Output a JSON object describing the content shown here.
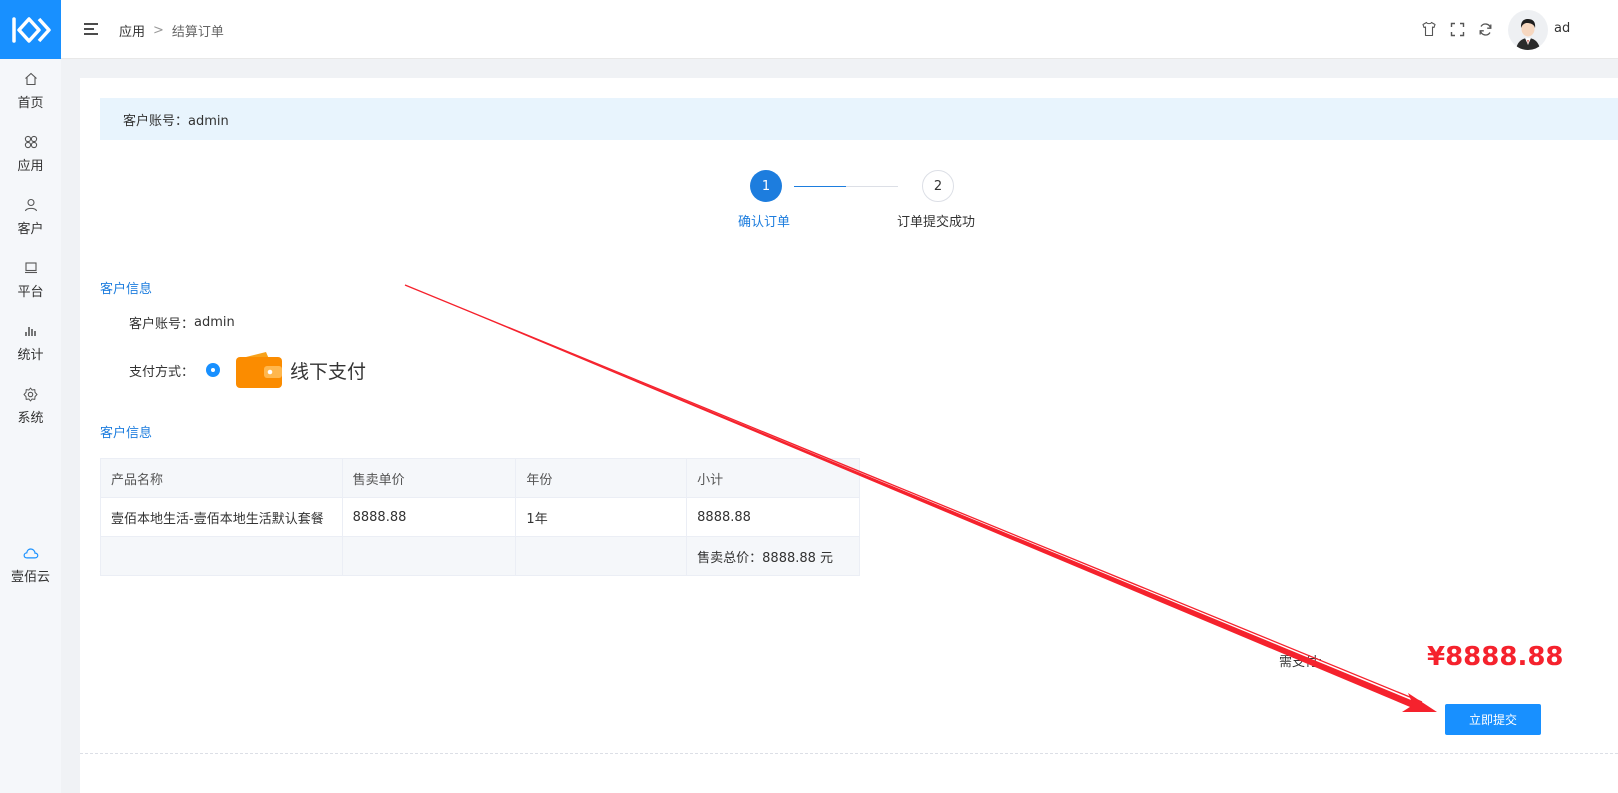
{
  "sidebar": {
    "items": [
      {
        "label": "首页",
        "icon": "home-icon"
      },
      {
        "label": "应用",
        "icon": "apps-icon"
      },
      {
        "label": "客户",
        "icon": "user-icon"
      },
      {
        "label": "平台",
        "icon": "monitor-icon"
      },
      {
        "label": "统计",
        "icon": "bar-chart-icon"
      },
      {
        "label": "系统",
        "icon": "gear-icon"
      }
    ],
    "cloud": {
      "label": "壹佰云",
      "icon": "cloud-icon"
    }
  },
  "header": {
    "breadcrumb": {
      "root": "应用",
      "separator": ">",
      "current": "结算订单"
    },
    "user_name": "ad"
  },
  "info_bar": {
    "text": "客户账号：admin"
  },
  "steps": [
    {
      "number": "1",
      "label": "确认订单",
      "active": true
    },
    {
      "number": "2",
      "label": "订单提交成功",
      "active": false
    }
  ],
  "customer_section": {
    "title": "客户信息",
    "account_label": "客户账号：",
    "account_value": "admin",
    "payment_label": "支付方式：",
    "payment_option": "线下支付"
  },
  "order_section": {
    "title": "客户信息",
    "columns": [
      "产品名称",
      "售卖单价",
      "年份",
      "小计"
    ],
    "rows": [
      [
        "壹佰本地生活-壹佰本地生活默认套餐",
        "8888.88",
        "1年",
        "8888.88"
      ]
    ],
    "total_text": "售卖总价：8888.88 元"
  },
  "payment": {
    "need_label": "需支付:",
    "amount": "¥8888.88"
  },
  "submit_button": {
    "label": "立即提交"
  },
  "colors": {
    "accent": "#1890ff",
    "step_active": "#1d7dde",
    "amount": "#f5222d",
    "annotation_arrow": "#f5222d"
  }
}
